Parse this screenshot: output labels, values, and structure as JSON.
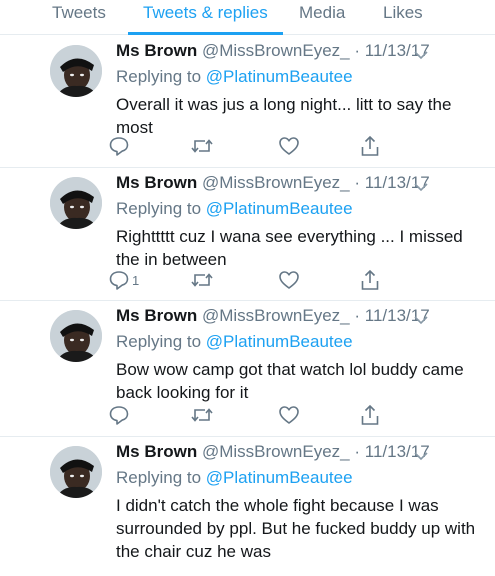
{
  "tabs": [
    {
      "label": "Tweets",
      "active": false
    },
    {
      "label": "Tweets & replies",
      "active": true
    },
    {
      "label": "Media",
      "active": false
    },
    {
      "label": "Likes",
      "active": false
    }
  ],
  "colors": {
    "accent": "#1da1f2",
    "secondary_text": "#657786",
    "divider": "#e6ecf0"
  },
  "icons": [
    "reply-icon",
    "retweet-icon",
    "like-icon",
    "share-icon",
    "chevron-down-icon"
  ],
  "tweets": [
    {
      "name": "Ms Brown",
      "handle": "@MissBrownEyez_",
      "dot": "·",
      "date": "11/13/17",
      "replying_prefix": "Replying to",
      "replying_to": "@PlatinumBeautee",
      "text": "Overall it was jus a long night... litt to say the most",
      "reply_count": ""
    },
    {
      "name": "Ms Brown",
      "handle": "@MissBrownEyez_",
      "dot": "·",
      "date": "11/13/17",
      "replying_prefix": "Replying to",
      "replying_to": "@PlatinumBeautee",
      "text": "Righttttt cuz I wana see everything ... I missed the in between",
      "reply_count": "1"
    },
    {
      "name": "Ms Brown",
      "handle": "@MissBrownEyez_",
      "dot": "·",
      "date": "11/13/17",
      "replying_prefix": "Replying to",
      "replying_to": "@PlatinumBeautee",
      "text": "Bow wow camp got that watch lol buddy came back looking for it",
      "reply_count": ""
    },
    {
      "name": "Ms Brown",
      "handle": "@MissBrownEyez_",
      "dot": "·",
      "date": "11/13/17",
      "replying_prefix": "Replying to",
      "replying_to": "@PlatinumBeautee",
      "text": "I didn't catch the whole fight because I was surrounded by ppl. But he fucked buddy up with the chair cuz he was",
      "reply_count": ""
    }
  ]
}
